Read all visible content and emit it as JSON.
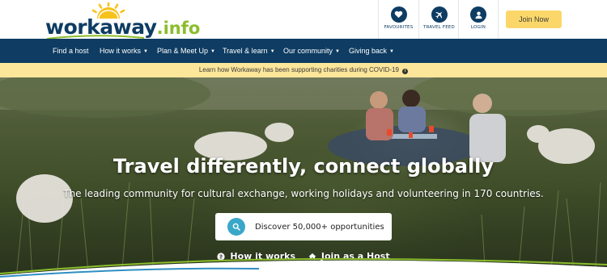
{
  "brand": {
    "name": "workaway",
    "suffix": ".info"
  },
  "header": {
    "favourites_label": "FAVOURITES",
    "travel_feed_label": "TRAVEL FEED",
    "login_label": "LOGIN",
    "join_label": "Join Now"
  },
  "nav": {
    "items": [
      {
        "label": "Find a host"
      },
      {
        "label": "How it works"
      },
      {
        "label": "Plan & Meet Up"
      },
      {
        "label": "Travel & learn"
      },
      {
        "label": "Our community"
      },
      {
        "label": "Giving back"
      }
    ]
  },
  "banner": {
    "text": "Learn how Workaway has been supporting charities during COVID-19",
    "info_icon": "i"
  },
  "hero": {
    "title": "Travel differently, connect globally",
    "subtitle": "The leading community for cultural exchange, working holidays and volunteering in 170 countries.",
    "discover_label": "Discover 50,000+ opportunities",
    "how_it_works_label": "How it works",
    "join_host_label": "Join as a Host"
  },
  "colors": {
    "navy": "#0e3c62",
    "join_yellow": "#fbd76a",
    "banner_yellow": "#fbe69a",
    "search_blue": "#3aa7c9",
    "logo_green": "#8bbd2c"
  }
}
